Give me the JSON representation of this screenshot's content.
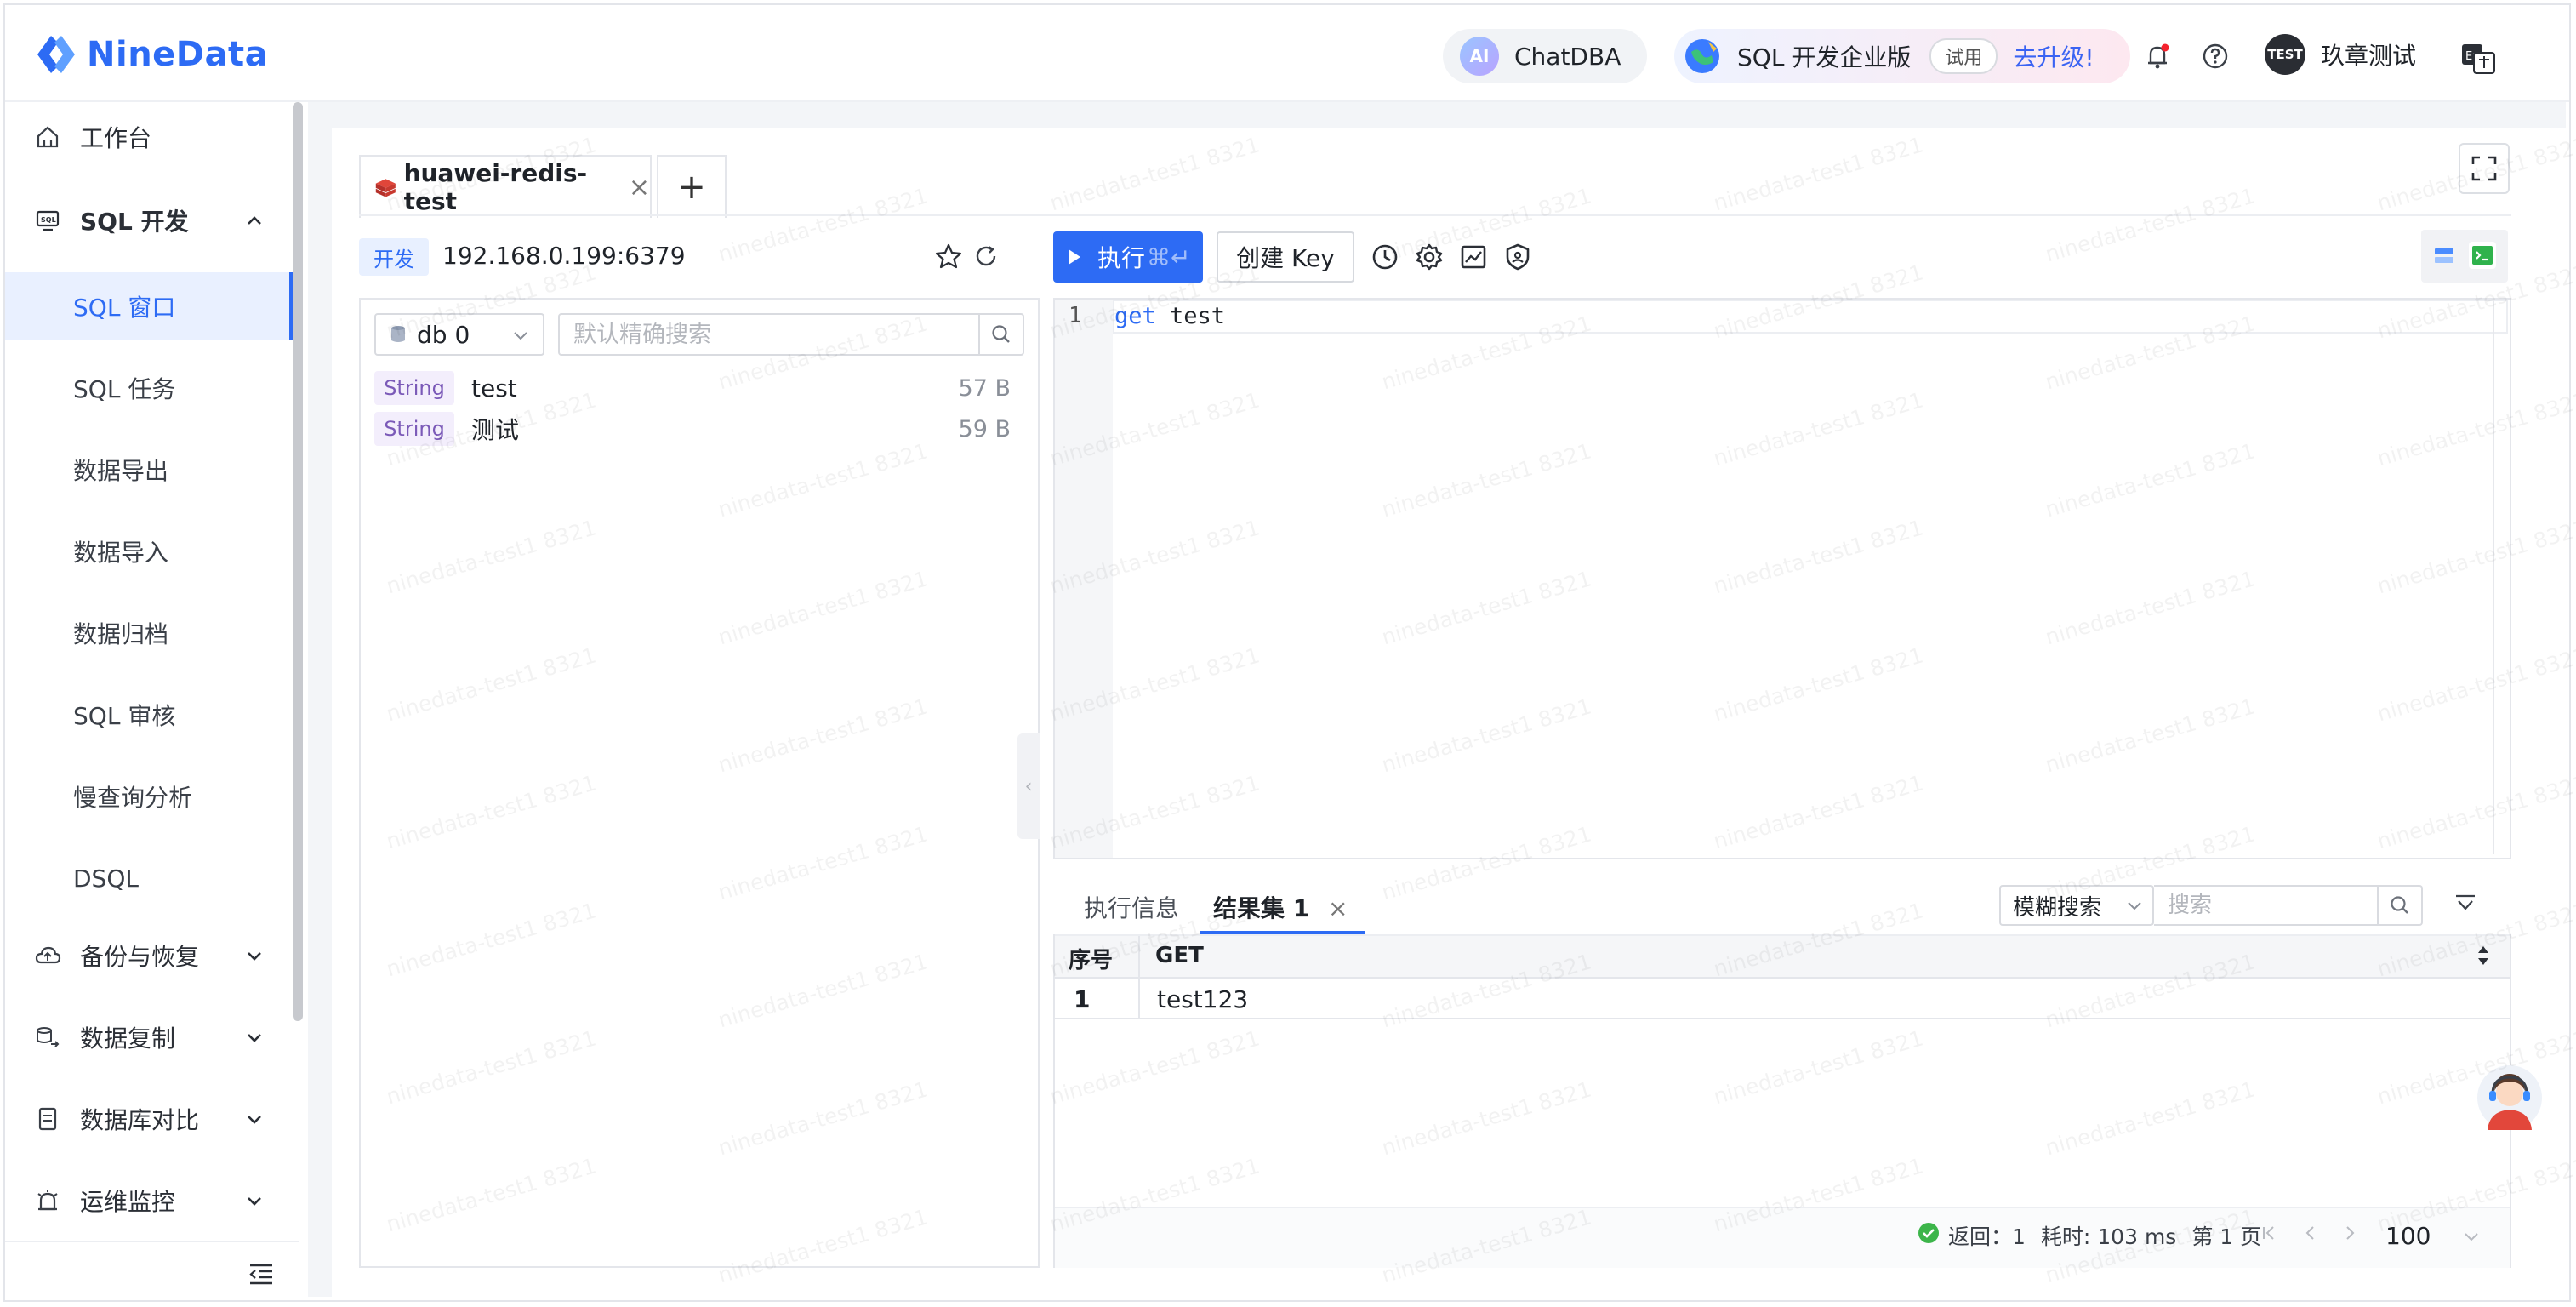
{
  "app": {
    "name": "NineData",
    "chatdba_label": "ChatDBA",
    "ai_badge": "AI",
    "edition_label": "SQL 开发企业版",
    "trial_label": "试用",
    "upgrade_label": "去升级!",
    "user_avatar_text": "TEST",
    "user_name": "玖章测试",
    "accent_color": "#2d6bf4"
  },
  "sidebar": {
    "workbench": "工作台",
    "sql_group": "SQL 开发",
    "sql_items": [
      "SQL 窗口",
      "SQL 任务",
      "数据导出",
      "数据导入",
      "数据归档",
      "SQL 审核",
      "慢查询分析",
      "DSQL"
    ],
    "active_item": "SQL 窗口",
    "groups": [
      "备份与恢复",
      "数据复制",
      "数据库对比",
      "运维监控"
    ]
  },
  "workspace": {
    "tab_name": "huawei-redis-test",
    "tab_close": "×",
    "add_tab": "+",
    "env_tag": "开发",
    "host": "192.168.0.199:6379"
  },
  "keys_panel": {
    "db_selected": "db 0",
    "search_placeholder": "默认精确搜索",
    "keys": [
      {
        "type": "String",
        "name": "test",
        "size": "57 B"
      },
      {
        "type": "String",
        "name": "测试",
        "size": "59 B"
      }
    ]
  },
  "toolbar": {
    "run_label": "执行",
    "run_shortcut": "⌘↵",
    "create_key_label": "创建 Key"
  },
  "editor": {
    "line_number": "1",
    "keyword": "get",
    "argument": " test"
  },
  "results": {
    "tab_info": "执行信息",
    "tab_result": "结果集 1",
    "tab_close": "×",
    "fuzzy_label": "模糊搜索",
    "search_placeholder": "搜索",
    "columns": [
      "序号",
      "GET"
    ],
    "rows": [
      [
        "1",
        "test123"
      ]
    ],
    "status": {
      "returned": "返回：1",
      "elapsed": "耗时: 103 ms",
      "page": "第 1 页",
      "page_size": "100"
    }
  },
  "watermark": "ninedata-test1 8321"
}
